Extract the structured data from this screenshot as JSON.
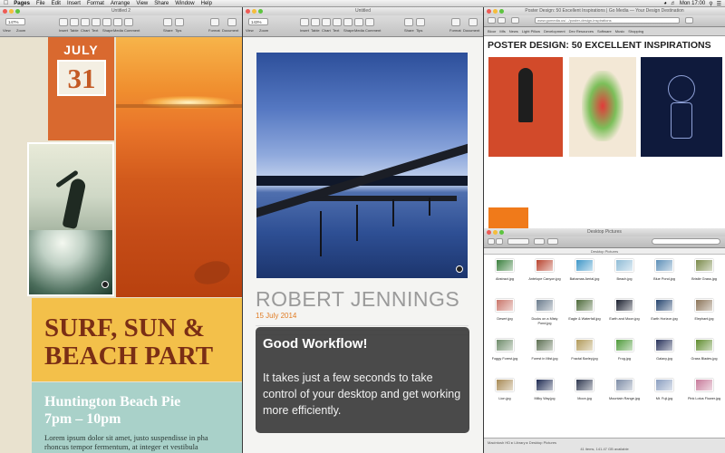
{
  "menubar": {
    "app": "Pages",
    "items": [
      "File",
      "Edit",
      "Insert",
      "Format",
      "Arrange",
      "View",
      "Share",
      "Window",
      "Help"
    ],
    "clock": "Mon 17:00"
  },
  "pages_left": {
    "title": "Untitled 2",
    "zoom": "147%",
    "toolbar_labels": [
      "View",
      "Zoom",
      "Insert",
      "Table",
      "Chart",
      "Text",
      "Shape",
      "Media",
      "Comment",
      "Share",
      "Tips",
      "Format",
      "Document"
    ],
    "date_month": "JULY",
    "date_day": "31",
    "headline_line1": "SURF, SUN &",
    "headline_line2": "BEACH PART",
    "event_line1": "Huntington Beach Pie",
    "event_line2": "7pm – 10pm",
    "body_line1": "Lorem ipsum dolor sit amet, justo suspendisse in pha",
    "body_line2": "rhoncus tempor fermentum, at integer et vestibula"
  },
  "pages_middle": {
    "title": "Untitled",
    "zoom": "143%",
    "toolbar_labels": [
      "View",
      "Zoom",
      "Insert",
      "Table",
      "Chart",
      "Text",
      "Shape",
      "Media",
      "Comment",
      "Share",
      "Tips",
      "Format",
      "Document"
    ],
    "author": "ROBERT JENNINGS",
    "date": "15 July 2014"
  },
  "notification": {
    "title": "Good Workflow!",
    "body": "It takes just a few seconds to take control of your desktop and get working more efficiently."
  },
  "browser": {
    "title": "Poster Design: 50 Excellent Inspirations | Go Media — Your Design Destination",
    "url": "www.gomedia.us/.../poster-design-inspirations",
    "bookmarks": [
      "Bloor",
      "Mfs",
      "News",
      "Light Pillow",
      "Development",
      "Dev Resources",
      "Software",
      "Music",
      "Shopping"
    ],
    "heading": "POSTER DESIGN: 50 EXCELLENT INSPIRATIONS"
  },
  "finder": {
    "title": "Desktop Pictures",
    "path_label": "Desktop Pictures",
    "status_path": "Macintosh HD ▸ Library ▸ Desktop Pictures",
    "status_info": "41 items, 141.47 GB available",
    "files": [
      {
        "name": "Abstract.jpg",
        "color": "#3a7f3d"
      },
      {
        "name": "Antelope Canyon.jpg",
        "color": "#b8432e"
      },
      {
        "name": "Bahamas Aerial.jpg",
        "color": "#3f97c8"
      },
      {
        "name": "Beach.jpg",
        "color": "#8fbcd6"
      },
      {
        "name": "Blue Pond.jpg",
        "color": "#5d8fb8"
      },
      {
        "name": "Bristle Grass.jpg",
        "color": "#7a8a4a"
      },
      {
        "name": "Desert.jpg",
        "color": "#c9756a"
      },
      {
        "name": "Ducks on a Misty Pond.jpg",
        "color": "#6a7b8c"
      },
      {
        "name": "Eagle & Waterfall.jpg",
        "color": "#4d6a3a"
      },
      {
        "name": "Earth and Moon.jpg",
        "color": "#1a1f2e"
      },
      {
        "name": "Earth Horizon.jpg",
        "color": "#25446e"
      },
      {
        "name": "Elephant.jpg",
        "color": "#8b7458"
      },
      {
        "name": "Foggy Forest.jpg",
        "color": "#6e8b6a"
      },
      {
        "name": "Forest in Mist.jpg",
        "color": "#5c6f52"
      },
      {
        "name": "Fractal Barley.jpg",
        "color": "#b29a5a"
      },
      {
        "name": "Frog.jpg",
        "color": "#4e9a3a"
      },
      {
        "name": "Galaxy.jpg",
        "color": "#27315a"
      },
      {
        "name": "Grass Blades.jpg",
        "color": "#5f8c2e"
      },
      {
        "name": "Lion.jpg",
        "color": "#a88a55"
      },
      {
        "name": "Milky Way.jpg",
        "color": "#1e2a52"
      },
      {
        "name": "Moon.jpg",
        "color": "#2f3850"
      },
      {
        "name": "Mountain Range.jpg",
        "color": "#7d8ca6"
      },
      {
        "name": "Mt. Fuji.jpg",
        "color": "#8a9ec0"
      },
      {
        "name": "Pink Lotus Flower.jpg",
        "color": "#c77a9a"
      }
    ]
  }
}
